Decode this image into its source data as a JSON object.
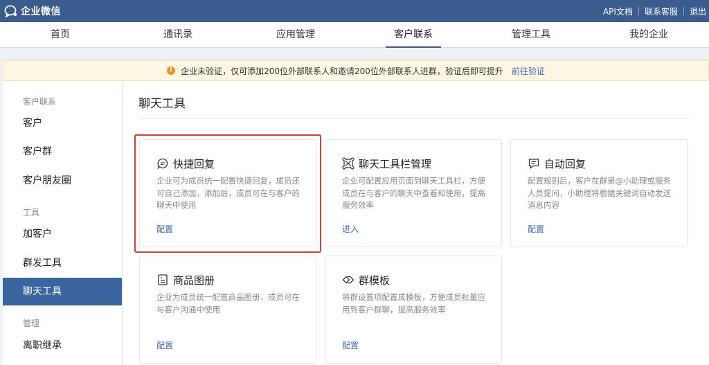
{
  "app": {
    "name": "企业微信"
  },
  "toplinks": [
    "API文档",
    "联系客服",
    "退出"
  ],
  "nav": {
    "items": [
      {
        "label": "首页"
      },
      {
        "label": "通讯录"
      },
      {
        "label": "应用管理"
      },
      {
        "label": "客户联系",
        "active": true
      },
      {
        "label": "管理工具"
      },
      {
        "label": "我的企业"
      }
    ]
  },
  "alert": {
    "icon": "warning-icon",
    "text": "企业未验证，仅可添加200位外部联系人和邀请200位外部联系人进群，验证后即可提升",
    "link": "前往验证"
  },
  "sidebar": {
    "groups": [
      {
        "label": "客户联系",
        "items": [
          "客户",
          "客户群",
          "客户朋友圈"
        ]
      },
      {
        "label": "工具",
        "items": [
          "加客户",
          "群发工具",
          "聊天工具"
        ]
      },
      {
        "label": "管理",
        "items": [
          "离职继承"
        ]
      }
    ],
    "active": "聊天工具"
  },
  "main": {
    "title": "聊天工具",
    "cards": [
      {
        "icon": "chat-bubble-icon",
        "title": "快捷回复",
        "desc": "企业可为成员统一配置快捷回复，成员还可自己添加，添加后，成员可在与客户的聊天中使用",
        "action": "配置"
      },
      {
        "icon": "toolbar-icon",
        "title": "聊天工具栏管理",
        "desc": "企业可配置应用页面到聊天工具栏，方便成员在与客户的聊天中查看和使用，提高服务效率",
        "action": "进入"
      },
      {
        "icon": "auto-reply-icon",
        "title": "自动回复",
        "desc": "配置规则后，客户在群里@小助理或服务人员提问，小助理将根据关键词自动发送消息内容",
        "action": "配置"
      },
      {
        "icon": "catalog-icon",
        "title": "商品图册",
        "desc": "企业为成员统一配置商品图册，成员可在与客户沟通中使用",
        "action": "配置"
      },
      {
        "icon": "template-icon",
        "title": "群模板",
        "desc": "将群设置项配置成模板，方便成员批量应用到客户群聊，提高服务效率",
        "action": "配置"
      }
    ]
  },
  "colors": {
    "topbar": "#3b5c8e",
    "accent": "#3b65a0",
    "link": "#3b6db6",
    "highlight": "#e53935",
    "alert_bg": "#fcf7e3"
  }
}
